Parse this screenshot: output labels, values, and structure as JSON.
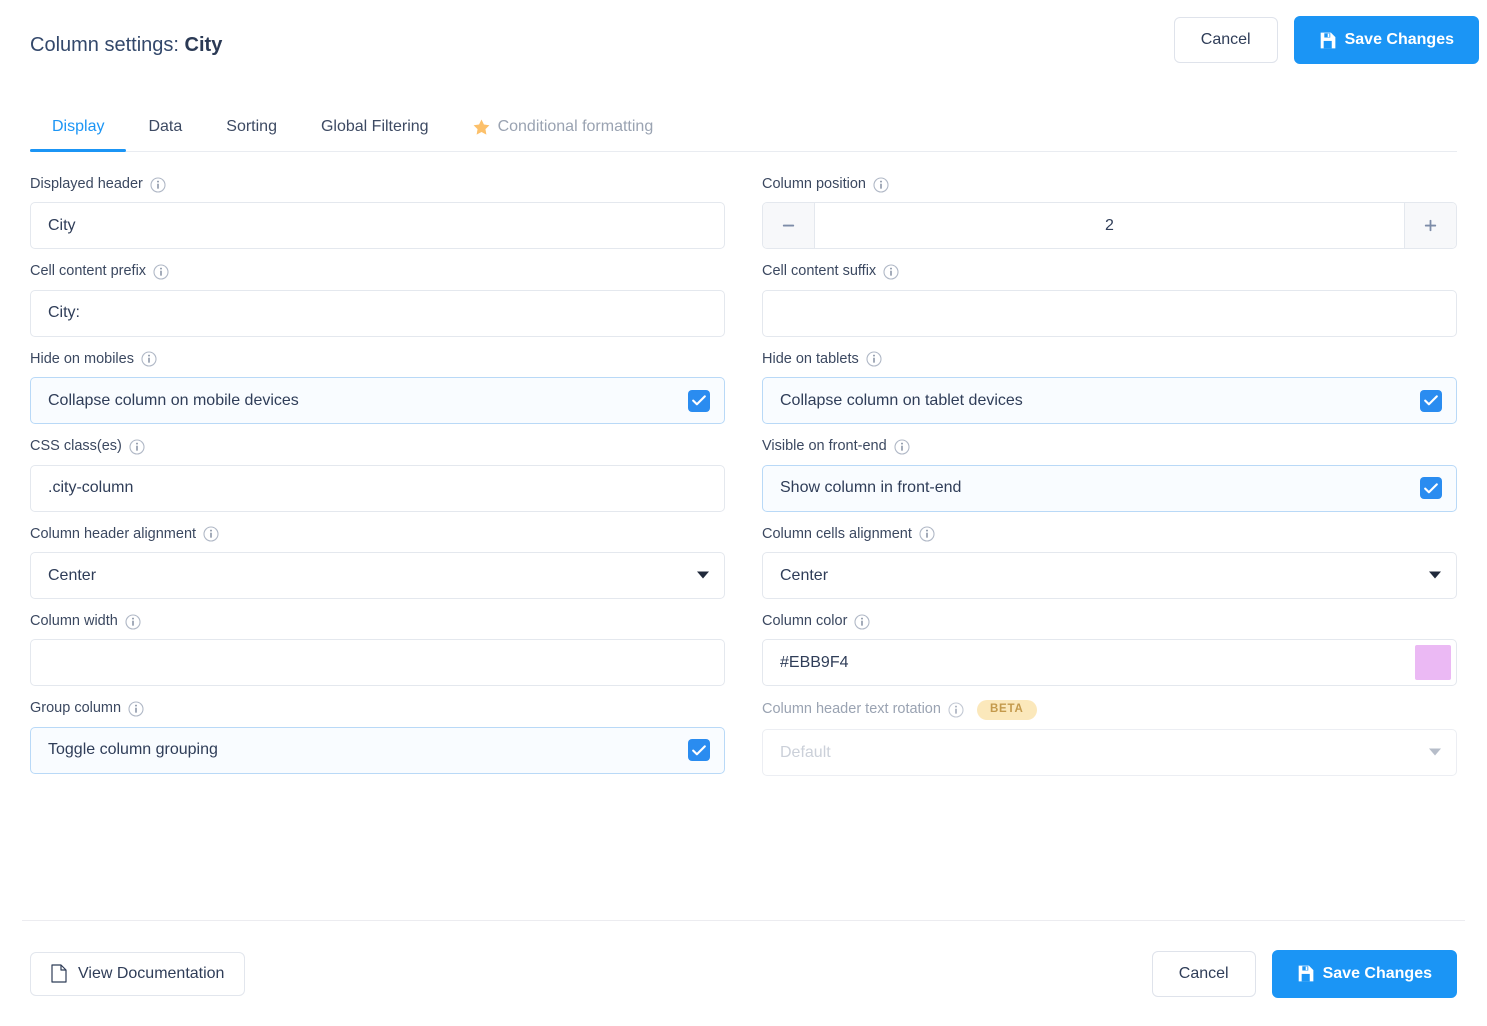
{
  "header": {
    "title_prefix": "Column settings:",
    "title_value": "City",
    "cancel_label": "Cancel",
    "save_label": "Save Changes",
    "save_icon": "floppy-disk-icon"
  },
  "tabs": [
    {
      "label": "Display",
      "state": "active"
    },
    {
      "label": "Data",
      "state": "default"
    },
    {
      "label": "Sorting",
      "state": "default"
    },
    {
      "label": "Global Filtering",
      "state": "default"
    },
    {
      "label": "Conditional formatting",
      "state": "muted",
      "icon": "star-icon"
    }
  ],
  "fields": {
    "displayed_header": {
      "label": "Displayed header",
      "value": "City",
      "placeholder": ""
    },
    "column_position": {
      "label": "Column position",
      "value": "2",
      "decrement_icon": "minus-icon",
      "increment_icon": "plus-icon"
    },
    "cell_content_prefix": {
      "label": "Cell content prefix",
      "value": "City:",
      "placeholder": ""
    },
    "cell_content_suffix": {
      "label": "Cell content suffix",
      "value": "",
      "placeholder": ""
    },
    "hide_on_mobiles": {
      "label": "Hide on mobiles",
      "option_label": "Collapse column on mobile devices",
      "checked": true
    },
    "hide_on_tablets": {
      "label": "Hide on tablets",
      "option_label": "Collapse column on tablet devices",
      "checked": true
    },
    "css_classes": {
      "label": "CSS class(es)",
      "value": ".city-column",
      "placeholder": ""
    },
    "visible_on_frontend": {
      "label": "Visible on front-end",
      "option_label": "Show column in front-end",
      "checked": true
    },
    "column_header_alignment": {
      "label": "Column header alignment",
      "value": "Center",
      "options": [
        "Center"
      ]
    },
    "column_cells_alignment": {
      "label": "Column cells alignment",
      "value": "Center",
      "options": [
        "Center"
      ]
    },
    "column_width": {
      "label": "Column width",
      "value": "",
      "placeholder": ""
    },
    "column_color": {
      "label": "Column color",
      "value": "#EBB9F4",
      "swatch_color": "#EBB9F4"
    },
    "group_column": {
      "label": "Group column",
      "option_label": "Toggle column grouping",
      "checked": true
    },
    "column_header_text_rotation": {
      "label": "Column header text rotation",
      "badge": "BETA",
      "value": "Default",
      "options": [
        "Default"
      ],
      "disabled": true
    }
  },
  "footer": {
    "documentation_label": "View Documentation",
    "documentation_icon": "document-icon",
    "cancel_label": "Cancel",
    "save_label": "Save Changes",
    "save_icon": "floppy-disk-icon"
  },
  "colors": {
    "accent": "#1b95f5",
    "checkbox": "#2a8cf0",
    "star": "#fcc06a",
    "badge_bg": "#fbe8bb",
    "badge_text": "#c49a4c",
    "swatch": "#EBB9F4"
  }
}
